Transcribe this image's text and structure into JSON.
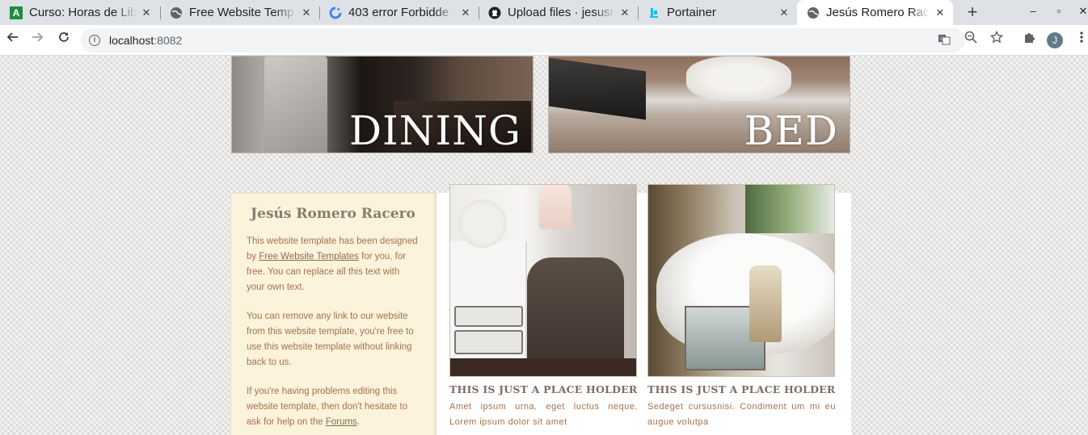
{
  "browser": {
    "tabs": [
      {
        "title": "Curso: Horas de Lib",
        "favicon": "A",
        "favicon_color": "#1e8e3e",
        "close": "✕"
      },
      {
        "title": "Free Website Temp",
        "favicon": "globe-icon",
        "favicon_color": "#5f6368",
        "close": "✕"
      },
      {
        "title": "403 error Forbidde",
        "favicon": "refresh-logo-icon",
        "favicon_color": "#4285f4",
        "close": "✕"
      },
      {
        "title": "Upload files · jesusr",
        "favicon": "github-icon",
        "favicon_color": "#202124",
        "close": "✕"
      },
      {
        "title": "Portainer",
        "favicon": "portainer-icon",
        "favicon_color": "#13bef9",
        "close": "✕"
      },
      {
        "title": "Jesús Romero Racero",
        "favicon": "globe-icon",
        "favicon_color": "#5f6368",
        "close": "✕",
        "active": true
      }
    ],
    "new_tab": "+",
    "window_controls": {
      "minimize": "–",
      "maximize": "▫",
      "close": "✕"
    },
    "url_host": "localhost",
    "url_port": ":8082",
    "avatar_letter": "J"
  },
  "page": {
    "categories": [
      {
        "label": "DINING"
      },
      {
        "label": "BED"
      }
    ],
    "sidebar": {
      "title": "Jesús Romero Racero",
      "p1_before": "This website template has been designed by ",
      "p1_link": "Free Website Templates",
      "p1_after": " for you, for free. You can replace all this text with your own text.",
      "p2": "You can remove any link to our website from this website template, you're free to use this website template without linking back to us.",
      "p3_before": "If you're having problems editing this website template, then don't hesitate to ask for help on the ",
      "p3_link": "Forums",
      "p3_after": "."
    },
    "placeholders": [
      {
        "title": "THIS IS JUST A PLACE HOLDER",
        "text": "Amet ipsum urna, eget luctus neque. Lorem ipsum dolor sit amet"
      },
      {
        "title": "THIS IS JUST A PLACE HOLDER",
        "text": "Sedeget cursusnisi. Condiment um mi eu augue volutpa"
      }
    ]
  },
  "colors": {
    "tabbar_bg": "#dee1e6",
    "sidebar_bg": "#fbf3dc",
    "body_text": "#a5714e",
    "heading": "#8b7b6e"
  }
}
